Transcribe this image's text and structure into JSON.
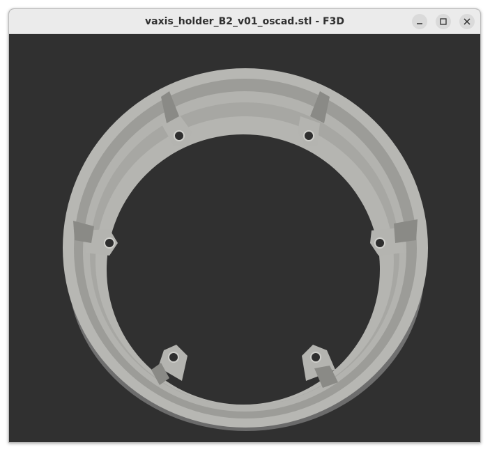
{
  "window": {
    "title": "vaxis_holder_B2_v01_oscad.stl - F3D",
    "controls": {
      "minimize": "minimize-icon",
      "maximize": "maximize-icon",
      "close": "close-icon"
    }
  },
  "viewport": {
    "background_color": "#303030",
    "model": {
      "shape": "ring holder with six mounting tabs",
      "mounting_hole_count": 6,
      "face_color": "#b6b6b2",
      "side_color": "#6e6e6e"
    }
  }
}
